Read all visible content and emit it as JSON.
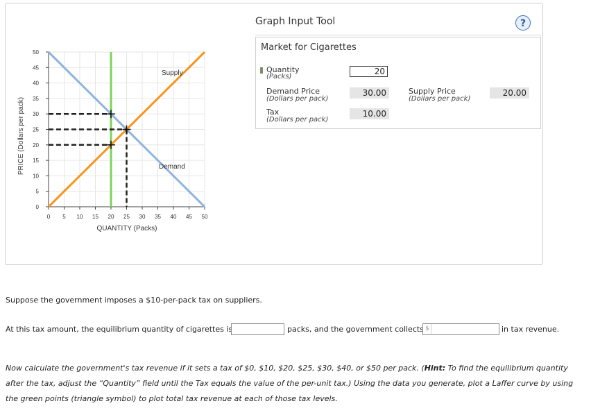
{
  "graph": {
    "ylabel": "PRICE (Dollars per pack)",
    "xlabel": "QUANTITY (Packs)",
    "x_ticks": [
      "0",
      "5",
      "10",
      "15",
      "20",
      "25",
      "30",
      "35",
      "40",
      "45",
      "50"
    ],
    "y_ticks": [
      "0",
      "5",
      "10",
      "15",
      "20",
      "25",
      "30",
      "35",
      "40",
      "45",
      "50"
    ],
    "supply_label": "Supply",
    "demand_label": "Demand",
    "colors": {
      "supply": "#f7941d",
      "demand": "#8fb4de",
      "quantity_line": "#7ed35a",
      "dashed": "#222222",
      "grid": "#e6e6e6"
    }
  },
  "chart_data": {
    "type": "line",
    "xlim": [
      0,
      50
    ],
    "ylim": [
      0,
      50
    ],
    "series": [
      {
        "name": "Supply",
        "points": [
          [
            0,
            0
          ],
          [
            50,
            50
          ]
        ]
      },
      {
        "name": "Demand",
        "points": [
          [
            0,
            50
          ],
          [
            50,
            0
          ]
        ]
      }
    ],
    "quantity_marker": 20,
    "equilibrium": {
      "quantity": 25,
      "price": 25
    },
    "demand_price_at_marker": 30,
    "supply_price_at_marker": 20
  },
  "tool": {
    "title": "Graph Input Tool",
    "help": "?",
    "market_title": "Market for Cigarettes",
    "quantity_label": "Quantity",
    "quantity_unit": "(Packs)",
    "quantity_value": "20",
    "demand_price_label": "Demand Price",
    "demand_price_unit": "(Dollars per pack)",
    "demand_price_value": "30.00",
    "supply_price_label": "Supply Price",
    "supply_price_unit": "(Dollars per pack)",
    "supply_price_value": "20.00",
    "tax_label": "Tax",
    "tax_unit": "(Dollars per pack)",
    "tax_value": "10.00"
  },
  "question": {
    "prompt": "Suppose the government imposes a $10-per-pack tax on suppliers.",
    "part1": "At this tax amount, the equilibrium quantity of cigarettes is",
    "part2": "packs, and the government collects",
    "dollar": "$",
    "part3": "in tax revenue."
  },
  "instructions": {
    "text1": "Now calculate the government's tax revenue if it sets a tax of $0, $10, $20, $25, $30, $40, or $50 per pack. (",
    "hint_label": "Hint:",
    "text2": " To find the equilibrium quantity after the tax, adjust the “Quantity” field until the Tax equals the value of the per-unit tax.) Using the data you generate, plot a Laffer curve by using the green points (triangle symbol) to plot total tax revenue at each of those tax levels."
  }
}
